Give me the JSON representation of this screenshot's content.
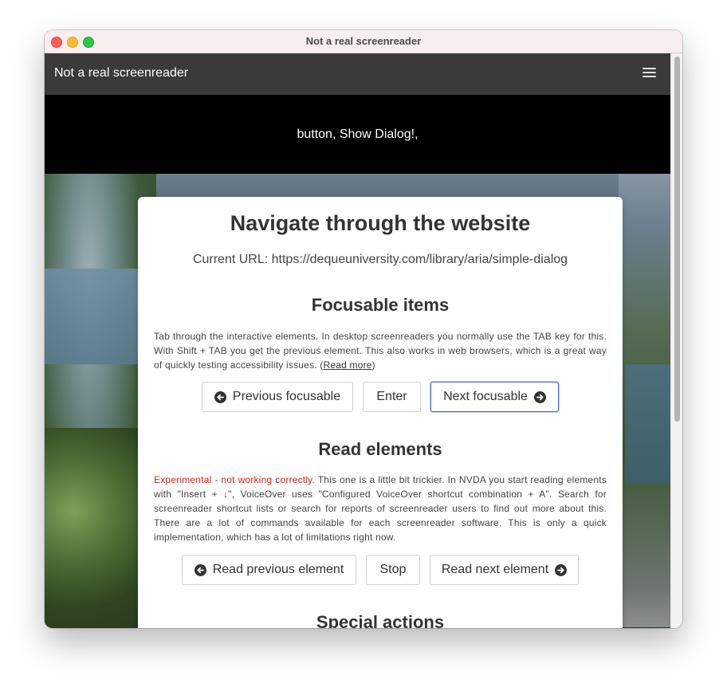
{
  "window": {
    "title": "Not a real screenreader"
  },
  "navbar": {
    "brand": "Not a real screenreader",
    "menu_icon": "hamburger-menu-icon"
  },
  "speech_output": "button, Show Dialog!,",
  "card": {
    "title": "Navigate through the website",
    "current_url": "Current URL: https://dequeuniversity.com/library/aria/simple-dialog"
  },
  "focusable": {
    "title": "Focusable items",
    "description": "Tab through the interactive elements. In desktop screenreaders you normally use the TAB key for this. With Shift + TAB you get the previous element. This also works in web browsers, which is a great way of quickly testing accessibility issues. (",
    "read_more": "Read more",
    "description_end": ")",
    "buttons": {
      "previous": "Previous focusable",
      "enter": "Enter",
      "next": "Next focusable"
    }
  },
  "read": {
    "title": "Read elements",
    "warning": "Experimental - not working correctly.",
    "description": " This one is a little bit trickier. In NVDA you start reading elements with \"Insert + ↓\", VoiceOver uses \"Configured VoiceOver shortcut combination + A\". Search for screenreader shortcut lists or search for reports of screenreader users to find out more about this. There are a lot of commands available for each screenreader software. This is only a quick implementation, which has a lot of limitations right now.",
    "buttons": {
      "previous": "Read previous element",
      "stop": "Stop",
      "next": "Read next element"
    }
  },
  "special": {
    "title": "Special actions"
  },
  "colors": {
    "navbar": "#3a3a3a",
    "speech_bar": "#000000",
    "warning": "#e0211c",
    "focus_ring": "#4a6cd4",
    "titlebar": "#f8eef0"
  }
}
